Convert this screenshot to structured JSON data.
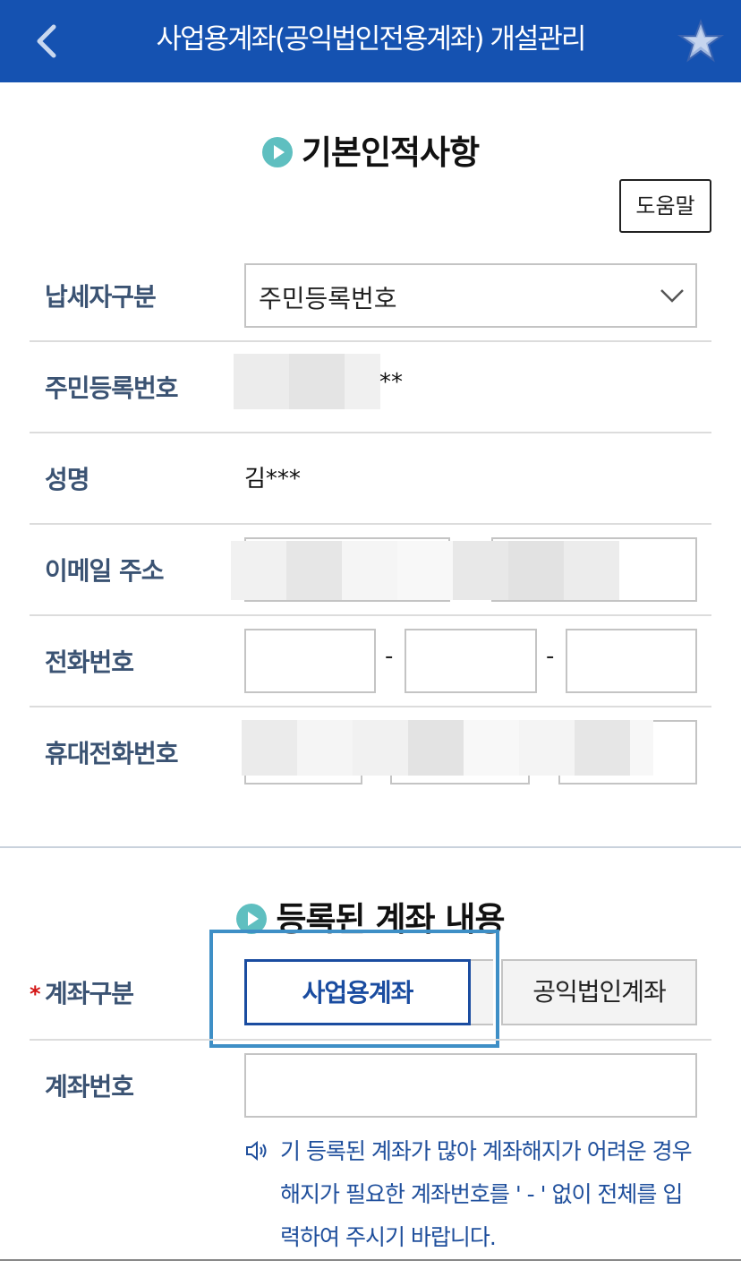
{
  "header": {
    "title": "사업용계좌(공익법인전용계좌) 개설관리",
    "back_icon": "chevron-left-icon",
    "favorite_icon": "star-icon",
    "bg_color": "#1552b1"
  },
  "section_basic": {
    "title": "기본인적사항",
    "icon": "play-circle-icon",
    "help_label": "도움말"
  },
  "fields": {
    "taxpayer_type": {
      "label": "납세자구분",
      "selected": "주민등록번호"
    },
    "rrn": {
      "label": "주민등록번호",
      "value_suffix": "**"
    },
    "name": {
      "label": "성명",
      "value": "김***"
    },
    "email": {
      "label": "이메일 주소"
    },
    "phone": {
      "label": "전화번호",
      "separator": "-"
    },
    "mobile": {
      "label": "휴대전화번호"
    }
  },
  "section_account": {
    "title": "등록된 계좌 내용",
    "icon": "play-circle-icon",
    "account_type": {
      "required_mark": "*",
      "label": "계좌구분",
      "options": [
        "사업용계좌",
        "공익법인계좌"
      ],
      "selected": "사업용계좌"
    },
    "account_number": {
      "label": "계좌번호",
      "value": ""
    },
    "notice": "기 등록된 계좌가 많아 계좌해지가 어려운 경우 해지가 필요한 계좌번호를 ' - ' 없이 전체를 입력하여 주시기 바랍니다.",
    "notice_icon": "speaker-icon"
  },
  "colors": {
    "accent_blue": "#1552b1",
    "focus_frame": "#3e8fc6",
    "label_text": "#3b5373",
    "required": "#d31414",
    "notice_text": "#1f4f9c"
  }
}
